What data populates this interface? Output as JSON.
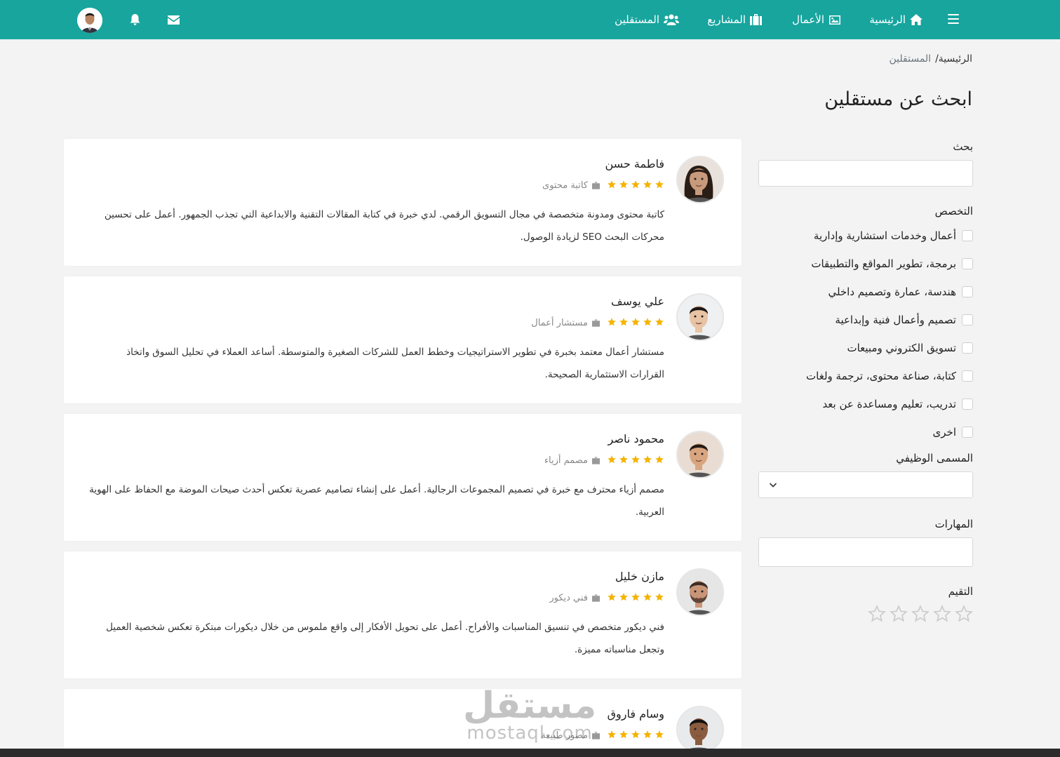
{
  "nav": {
    "home": "الرئيسية",
    "works": "الأعمال",
    "projects": "المشاريع",
    "freelancers": "المستقلين"
  },
  "breadcrumb": {
    "home": "الرئيسية/",
    "current": "المستقلين"
  },
  "page_title": "ابحث عن مستقلين",
  "filters": {
    "search_label": "بحث",
    "specialty_label": "التخصص",
    "specialties": [
      "أعمال وخدمات استشارية وإدارية",
      "برمجة، تطوير المواقع والتطبيقات",
      "هندسة، عمارة وتصميم داخلي",
      "تصميم وأعمال فنية وإبداعية",
      "تسويق الكتروني ومبيعات",
      "كتابة، صناعة محتوى، ترجمة ولغات",
      "تدريب، تعليم ومساعدة عن بعد",
      "اخرى"
    ],
    "job_title_label": "المسمى الوظيفي",
    "skills_label": "المهارات",
    "rating_label": "التقيم",
    "rating_value": 0
  },
  "freelancers": [
    {
      "name": "فاطمة حسن",
      "job": "كاتبة محتوى",
      "rating": 5,
      "bio": "كاتبة محتوى ومدونة متخصصة في مجال التسويق الرقمي. لدي خبرة في كتابة المقالات التقنية والابداعية التي تجذب الجمهور. أعمل على تحسين محركات البحث SEO لزيادة الوصول."
    },
    {
      "name": "علي يوسف",
      "job": "مستشار أعمال",
      "rating": 5,
      "bio": "مستشار أعمال معتمد بخبرة في تطوير الاستراتيجيات وخطط العمل للشركات الصغيرة والمتوسطة. أساعد العملاء في تحليل السوق واتخاذ القرارات الاستثمارية الصحيحة."
    },
    {
      "name": "محمود ناصر",
      "job": "مصمم أزياء",
      "rating": 5,
      "bio": "مصمم أزياء محترف مع خبرة في تصميم المجموعات الرجالية. أعمل على إنشاء تصاميم عصرية تعكس أحدث صيحات الموضة مع الحفاظ على الهوية العربية."
    },
    {
      "name": "مازن خليل",
      "job": "فني ديكور",
      "rating": 5,
      "bio": "فني ديكور متخصص في تنسيق المناسبات والأفراح. أعمل على تحويل الأفكار إلى واقع ملموس من خلال ديكورات مبتكرة تعكس شخصية العميل وتجعل مناسباته مميزة."
    },
    {
      "name": "وسام فاروق",
      "job": "مصور طبيعة",
      "rating": 5,
      "bio": ""
    }
  ],
  "colors": {
    "primary": "#17a59e",
    "star": "#f5b301",
    "star_empty": "#cccccc"
  },
  "watermark": {
    "ar": "مستقل",
    "en": "mostaql.com"
  }
}
